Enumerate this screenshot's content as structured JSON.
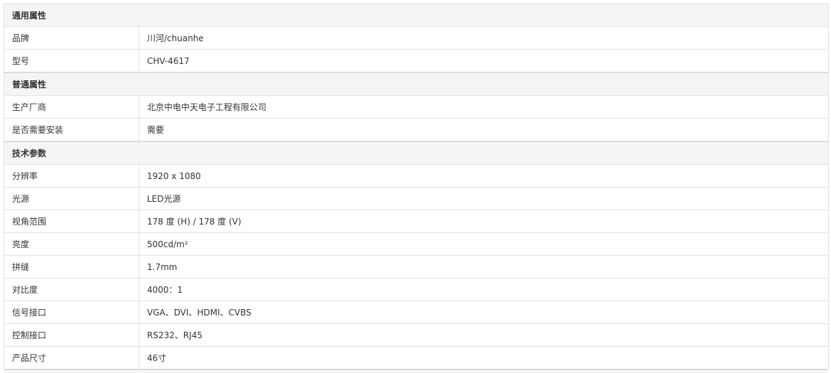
{
  "groups": [
    {
      "title": "通用属性",
      "rows": [
        {
          "key": "品牌",
          "value": "川河/chuanhe"
        },
        {
          "key": "型号",
          "value": "CHV-4617"
        }
      ]
    },
    {
      "title": "普通属性",
      "rows": [
        {
          "key": "生产厂商",
          "value": "北京中电中天电子工程有限公司"
        },
        {
          "key": "是否需要安装",
          "value": "需要"
        }
      ]
    },
    {
      "title": "技术参数",
      "rows": [
        {
          "key": "分辨率",
          "value": "1920 x 1080"
        },
        {
          "key": "光源",
          "value": "LED光源"
        },
        {
          "key": "视角范围",
          "value": "178 度 (H) / 178 度 (V)"
        },
        {
          "key": "亮度",
          "value": "500cd/m²"
        },
        {
          "key": "拼缝",
          "value": "1.7mm"
        },
        {
          "key": "对比度",
          "value": "4000：1"
        },
        {
          "key": "信号接口",
          "value": "VGA、DVI、HDMI、CVBS"
        },
        {
          "key": "控制接口",
          "value": "RS232、RJ45"
        },
        {
          "key": "产品尺寸",
          "value": "46寸"
        }
      ]
    }
  ]
}
